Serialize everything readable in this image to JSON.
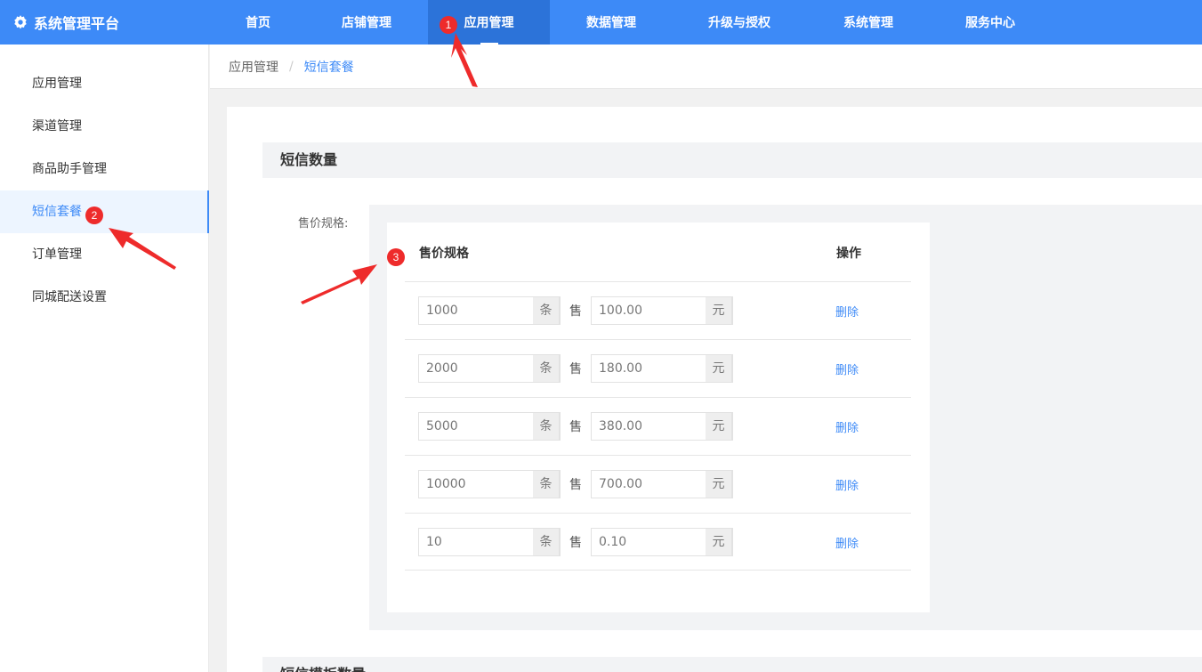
{
  "header": {
    "brand": "系统管理平台",
    "nav": [
      {
        "label": "首页"
      },
      {
        "label": "店铺管理"
      },
      {
        "label": "应用管理"
      },
      {
        "label": "数据管理"
      },
      {
        "label": "升级与授权"
      },
      {
        "label": "系统管理"
      },
      {
        "label": "服务中心"
      }
    ],
    "active_index": 2
  },
  "sidebar": {
    "items": [
      {
        "label": "应用管理"
      },
      {
        "label": "渠道管理"
      },
      {
        "label": "商品助手管理"
      },
      {
        "label": "短信套餐"
      },
      {
        "label": "订单管理"
      },
      {
        "label": "同城配送设置"
      }
    ],
    "active_index": 3
  },
  "breadcrumb": {
    "parent": "应用管理",
    "separator": "/",
    "current": "短信套餐"
  },
  "main": {
    "section1_title": "短信数量",
    "field_label": "售价规格:",
    "table": {
      "col_spec": "售价规格",
      "col_op": "操作",
      "count_unit": "条",
      "sell_label": "售",
      "price_unit": "元",
      "delete_label": "删除",
      "rows": [
        {
          "count": "1000",
          "price": "100.00"
        },
        {
          "count": "2000",
          "price": "180.00"
        },
        {
          "count": "5000",
          "price": "380.00"
        },
        {
          "count": "10000",
          "price": "700.00"
        },
        {
          "count": "10",
          "price": "0.10"
        }
      ]
    },
    "section2_title": "短信模板数量"
  },
  "annotations": {
    "markers": [
      "1",
      "2",
      "3"
    ],
    "color": "#ee2b2b"
  },
  "colors": {
    "primary": "#3d8af7",
    "nav_active": "#2c73d9"
  }
}
